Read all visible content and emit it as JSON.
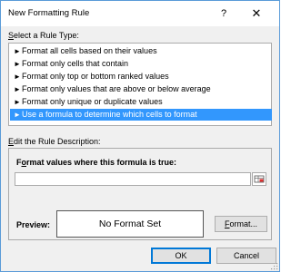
{
  "window": {
    "title": "New Formatting Rule",
    "help_label": "?",
    "close_label": "✕"
  },
  "rule_type": {
    "label_key": "S",
    "label_rest": "elect a Rule Type:",
    "items": [
      {
        "label": "Format all cells based on their values",
        "selected": false
      },
      {
        "label": "Format only cells that contain",
        "selected": false
      },
      {
        "label": "Format only top or bottom ranked values",
        "selected": false
      },
      {
        "label": "Format only values that are above or below average",
        "selected": false
      },
      {
        "label": "Format only unique or duplicate values",
        "selected": false
      },
      {
        "label": "Use a formula to determine which cells to format",
        "selected": true
      }
    ],
    "arrow_icon": "►"
  },
  "description": {
    "label_key": "E",
    "label_rest": "dit the Rule Description:",
    "formula_label_key": "o",
    "formula_label_pre": "F",
    "formula_label_rest": "rmat values where this formula is true:",
    "formula_value": "",
    "preview_label": "Preview:",
    "preview_text": "No Format Set",
    "format_button_key": "F",
    "format_button_rest": "ormat..."
  },
  "buttons": {
    "ok": "OK",
    "cancel": "Cancel"
  },
  "colors": {
    "selection": "#3297fd",
    "dialog_border": "#5a9bd8",
    "default_button_border": "#0078d7"
  }
}
